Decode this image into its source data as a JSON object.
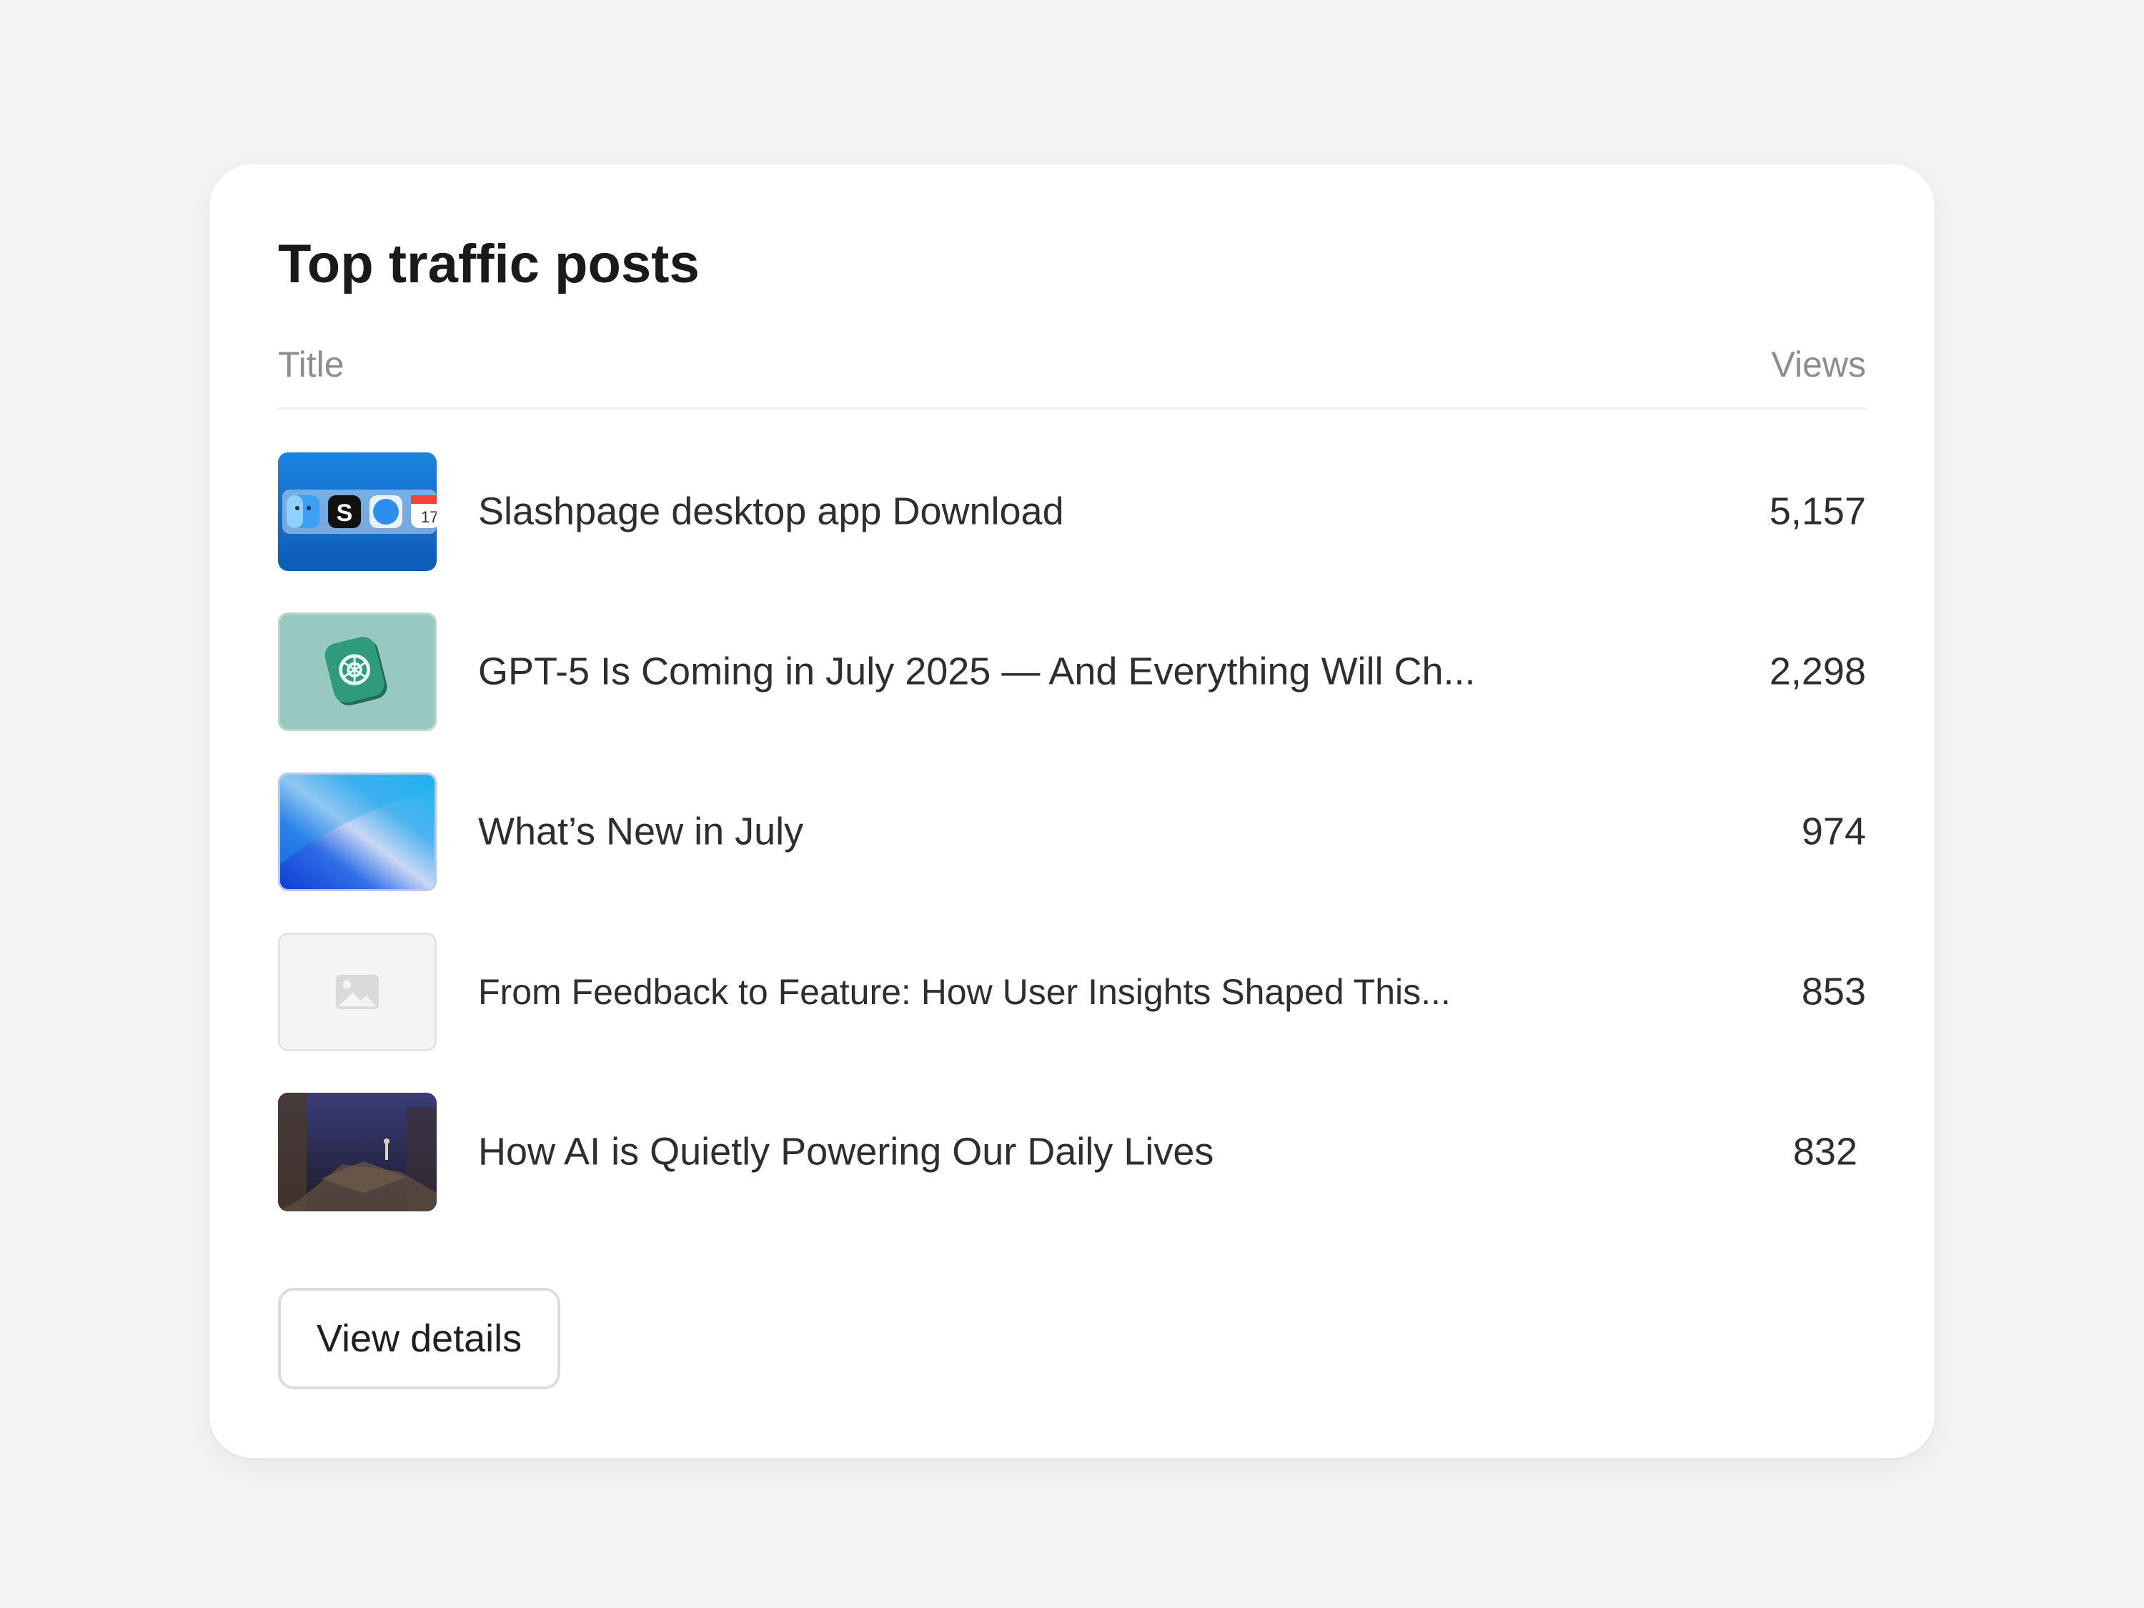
{
  "widget": {
    "title": "Top traffic posts",
    "columns": {
      "title": "Title",
      "views": "Views"
    },
    "posts": [
      {
        "title": "Slashpage desktop app Download",
        "views": "5,157",
        "thumbnail": "mac-dock-icons"
      },
      {
        "title": "GPT-5 Is Coming in July 2025 — And Everything Will Ch...",
        "views": "2,298",
        "thumbnail": "openai-logo-tile"
      },
      {
        "title": "What’s New in July",
        "views": "974",
        "thumbnail": "blue-gradient-abstract"
      },
      {
        "title": "From Feedback to Feature: How User Insights Shaped This...",
        "views": "853",
        "thumbnail": "image-placeholder-icon"
      },
      {
        "title": "How AI is Quietly Powering Our Daily Lives",
        "views": "832",
        "thumbnail": "dark-game-scene"
      }
    ],
    "button_label": "View details"
  },
  "colors": {
    "page_background": "#f3f3f3",
    "card_background": "#ffffff",
    "muted_text": "#8d8d8d",
    "primary_text": "#1a1a1a"
  }
}
